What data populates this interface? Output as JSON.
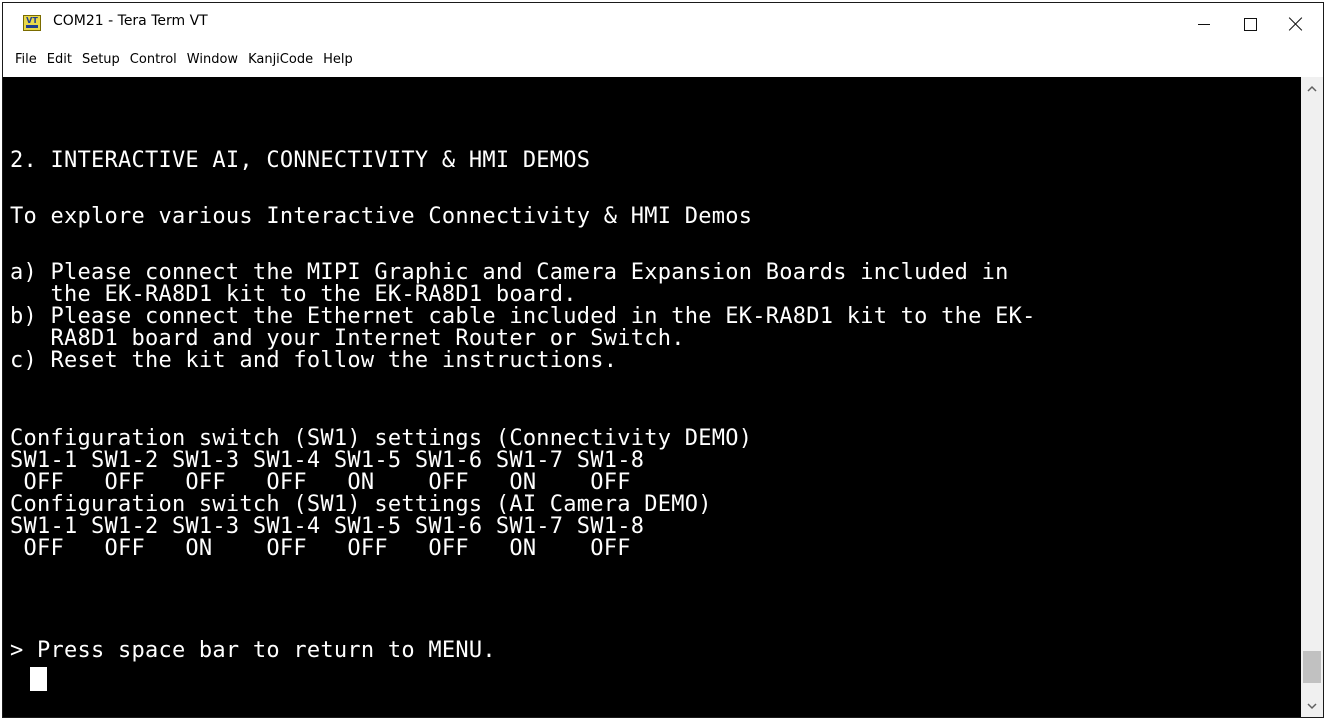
{
  "window": {
    "title": "COM21 - Tera Term VT",
    "icon": "tera-term-vt-icon",
    "icon_label": "VT"
  },
  "menu": {
    "items": [
      "File",
      "Edit",
      "Setup",
      "Control",
      "Window",
      "KanjiCode",
      "Help"
    ]
  },
  "terminal": {
    "lines": [
      "2. INTERACTIVE AI, CONNECTIVITY & HMI DEMOS",
      "To explore various Interactive Connectivity & HMI Demos",
      "a) Please connect the MIPI Graphic and Camera Expansion Boards included in",
      "   the EK-RA8D1 kit to the EK-RA8D1 board.",
      "b) Please connect the Ethernet cable included in the EK-RA8D1 kit to the EK-",
      "   RA8D1 board and your Internet Router or Switch.",
      "c) Reset the kit and follow the instructions.",
      "Configuration switch (SW1) settings (Connectivity DEMO)",
      "SW1-1 SW1-2 SW1-3 SW1-4 SW1-5 SW1-6 SW1-7 SW1-8",
      " OFF   OFF   OFF   OFF   ON    OFF   ON    OFF",
      "Configuration switch (SW1) settings (AI Camera DEMO)",
      "SW1-1 SW1-2 SW1-3 SW1-4 SW1-5 SW1-6 SW1-7 SW1-8",
      " OFF   OFF   ON    OFF   OFF   OFF   ON    OFF",
      "> Press space bar to return to MENU."
    ],
    "colors": {
      "background": "#000000",
      "foreground": "#ffffff"
    }
  }
}
